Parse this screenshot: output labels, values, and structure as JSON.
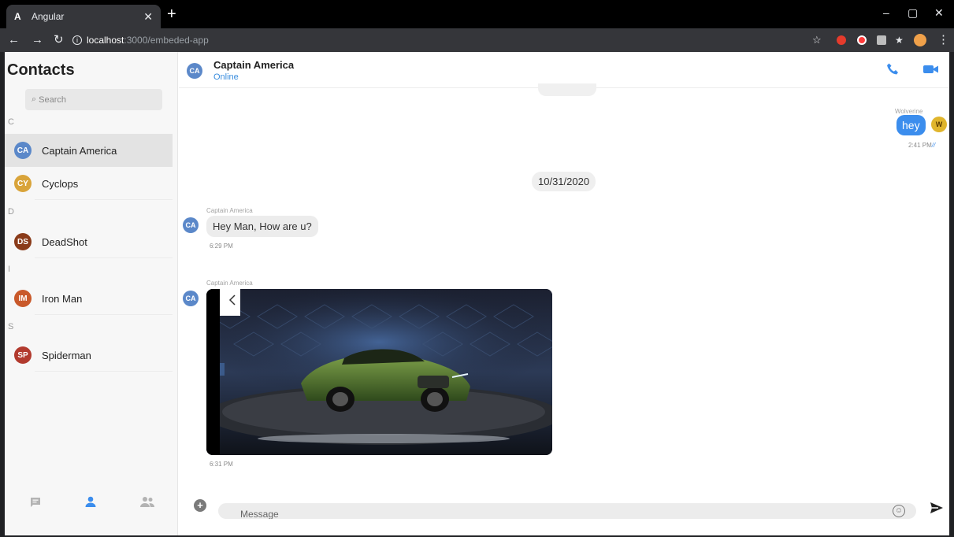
{
  "browser": {
    "tab_title": "Angular",
    "tab_favicon": "A",
    "url_host": "localhost",
    "url_path": ":3000/embeded-app"
  },
  "sidebar": {
    "title": "Contacts",
    "search_placeholder": "Search",
    "groups": [
      {
        "letter": "C",
        "contacts": [
          {
            "name": "Captain America",
            "initials": "CA",
            "color": "#5b88c9",
            "active": true
          },
          {
            "name": "Cyclops",
            "initials": "CY",
            "color": "#d9a43a"
          }
        ]
      },
      {
        "letter": "D",
        "contacts": [
          {
            "name": "DeadShot",
            "initials": "DS",
            "color": "#8a3b1a"
          }
        ]
      },
      {
        "letter": "I",
        "contacts": [
          {
            "name": "Iron Man",
            "initials": "IM",
            "color": "#c9592a"
          }
        ]
      },
      {
        "letter": "S",
        "contacts": [
          {
            "name": "Spiderman",
            "initials": "SP",
            "color": "#b23a2e"
          }
        ]
      }
    ],
    "bottom_nav": [
      "chat-icon",
      "person-icon",
      "group-icon"
    ],
    "active_nav": "person-icon"
  },
  "chat": {
    "name": "Captain America",
    "initials": "CA",
    "status": "Online",
    "messages": {
      "outgoing": {
        "sender": "Wolverine",
        "text": "hey",
        "time": "2:41 PM",
        "ticks": "//",
        "avatar": "W"
      },
      "date_divider": "10/31/2020",
      "incoming_text": {
        "sender": "Captain America",
        "text": "Hey Man, How are u?",
        "time": "6:29 PM"
      },
      "incoming_image": {
        "sender": "Captain America",
        "time": "6:31 PM",
        "image_alt": "green sports car on display platform"
      }
    },
    "composer_placeholder": "Message"
  },
  "colors": {
    "accent": "#3b8ded",
    "online": "#3a8dde"
  }
}
